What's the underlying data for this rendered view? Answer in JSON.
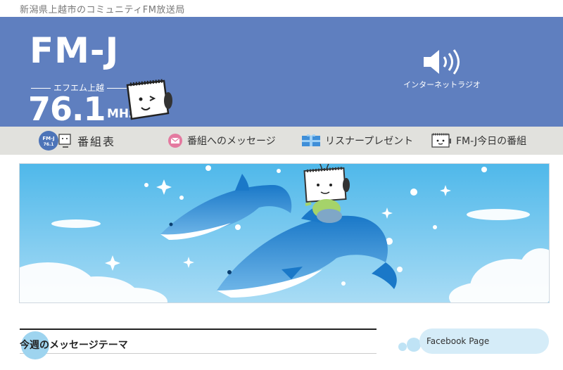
{
  "site": {
    "tagline": "新潟県上越市のコミュニティFM放送局"
  },
  "logo": {
    "brand": "FM-J",
    "subtitle": "エフエム上越",
    "frequency": "76.1",
    "unit": "MHz"
  },
  "header": {
    "radio_link_label": "インターネットラジオ",
    "radio_icon": "speaker-icon"
  },
  "nav": {
    "items": [
      {
        "label": "番組表",
        "icon": "fmj-mascot-icon"
      },
      {
        "label": "番組へのメッセージ",
        "icon": "mail-icon"
      },
      {
        "label": "リスナープレゼント",
        "icon": "gift-icon"
      },
      {
        "label": "FM-J今日の番組",
        "icon": "mascot-radio-icon"
      }
    ]
  },
  "hero": {
    "image": "dolphins-banner"
  },
  "sections": {
    "message_theme_title": "今週のメッセージテーマ",
    "facebook_title": "Facebook Page"
  },
  "colors": {
    "header_bg": "#5f7fbf",
    "nav_bg": "#e1e1dd",
    "sky": "#5fc3ee",
    "accent_bubble": "#9ed4ef"
  }
}
